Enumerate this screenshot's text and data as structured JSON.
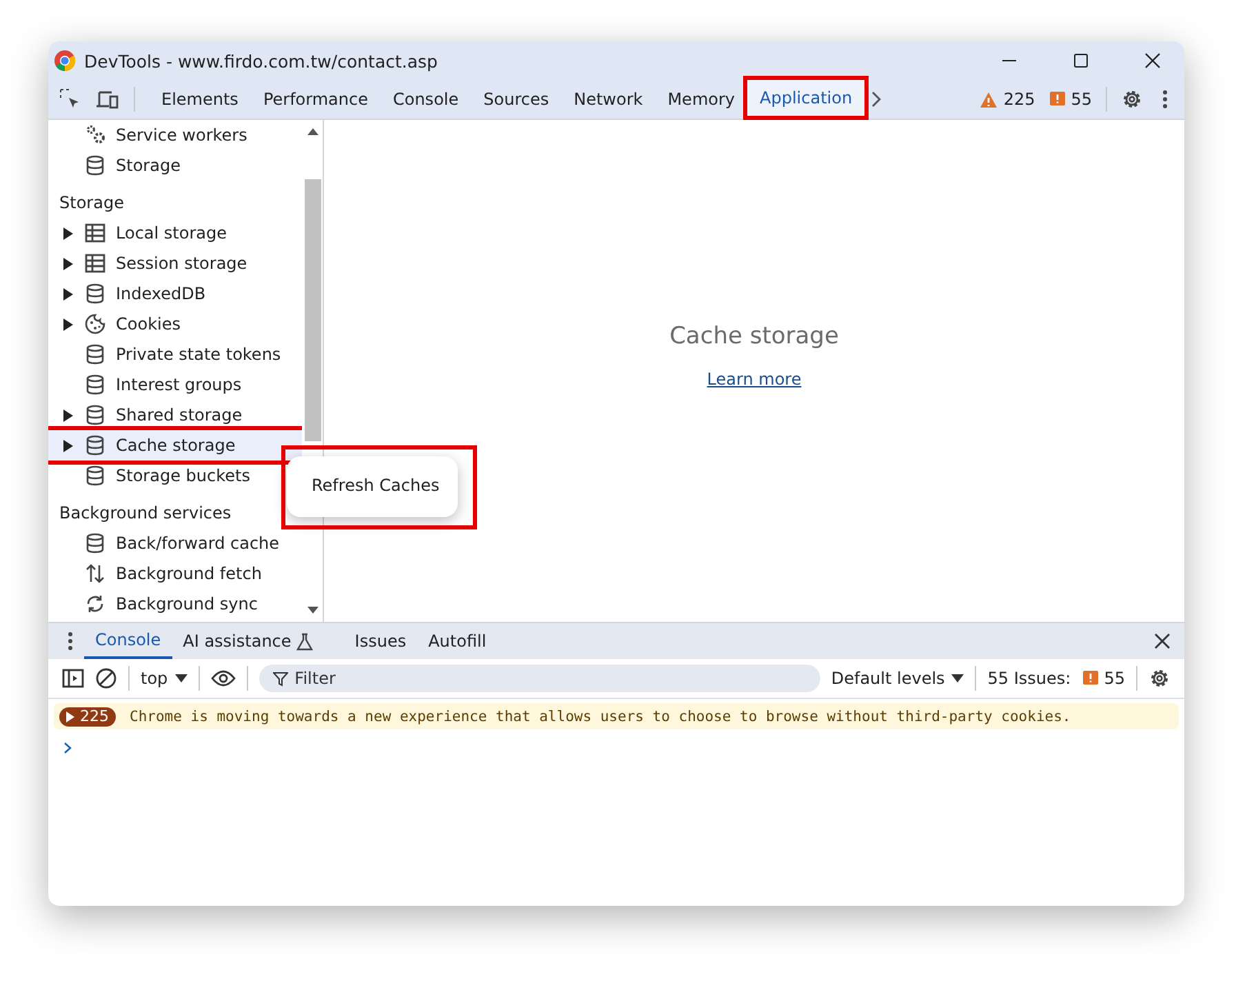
{
  "window": {
    "title": "DevTools - www.firdo.com.tw/contact.asp"
  },
  "tabs": [
    {
      "label": "Elements",
      "selected": false
    },
    {
      "label": "Performance",
      "selected": false
    },
    {
      "label": "Console",
      "selected": false
    },
    {
      "label": "Sources",
      "selected": false
    },
    {
      "label": "Network",
      "selected": false
    },
    {
      "label": "Memory",
      "selected": false
    },
    {
      "label": "Application",
      "selected": true,
      "highlighted": true
    }
  ],
  "counters": {
    "warnings": "225",
    "issues": "55"
  },
  "sidebar": {
    "sections": [
      {
        "items": [
          {
            "label": "Service workers",
            "kind": "worker",
            "expandable": false,
            "selected": false
          },
          {
            "label": "Storage",
            "kind": "database",
            "expandable": false,
            "selected": false
          }
        ]
      },
      {
        "heading": "Storage",
        "items": [
          {
            "label": "Local storage",
            "kind": "table",
            "expandable": true,
            "selected": false
          },
          {
            "label": "Session storage",
            "kind": "table",
            "expandable": true,
            "selected": false
          },
          {
            "label": "IndexedDB",
            "kind": "database",
            "expandable": true,
            "selected": false
          },
          {
            "label": "Cookies",
            "kind": "cookie",
            "expandable": true,
            "selected": false
          },
          {
            "label": "Private state tokens",
            "kind": "database",
            "expandable": false,
            "selected": false
          },
          {
            "label": "Interest groups",
            "kind": "database",
            "expandable": false,
            "selected": false
          },
          {
            "label": "Shared storage",
            "kind": "database",
            "expandable": true,
            "selected": false
          },
          {
            "label": "Cache storage",
            "kind": "database",
            "expandable": true,
            "selected": true,
            "highlighted": true
          },
          {
            "label": "Storage buckets",
            "kind": "database",
            "expandable": false,
            "selected": false
          }
        ]
      },
      {
        "heading": "Background services",
        "items": [
          {
            "label": "Back/forward cache",
            "kind": "database",
            "expandable": false,
            "selected": false
          },
          {
            "label": "Background fetch",
            "kind": "transfer",
            "expandable": false,
            "selected": false
          },
          {
            "label": "Background sync",
            "kind": "sync",
            "expandable": false,
            "selected": false
          }
        ]
      }
    ]
  },
  "context_menu": {
    "highlighted": true,
    "items": [
      {
        "label": "Refresh Caches"
      }
    ]
  },
  "main": {
    "title": "Cache storage",
    "link": "Learn more"
  },
  "drawer": {
    "tabs": [
      {
        "label": "Console",
        "selected": true,
        "experimental": false
      },
      {
        "label": "AI assistance",
        "selected": false,
        "experimental": true
      },
      {
        "label": "Issues",
        "selected": false,
        "experimental": false
      },
      {
        "label": "Autofill",
        "selected": false,
        "experimental": false
      }
    ],
    "context": "top",
    "filter": {
      "placeholder": "Filter"
    },
    "levels": "Default levels",
    "issues_label": "55 Issues:",
    "issues_count": "55",
    "messages": [
      {
        "count": "225",
        "text": "Chrome is moving towards a new experience that allows users to choose to browse without third-party cookies."
      }
    ]
  }
}
